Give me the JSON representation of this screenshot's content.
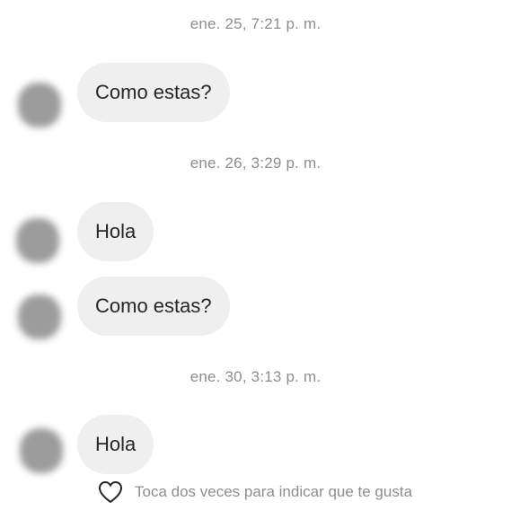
{
  "thread": {
    "timestamps": [
      "ene. 25, 7:21 p. m.",
      "ene. 26, 3:29 p. m.",
      "ene. 30, 3:13 p. m."
    ],
    "messages": [
      {
        "text": "Como estas?"
      },
      {
        "text": "Hola"
      },
      {
        "text": "Como estas?"
      },
      {
        "text": "Hola"
      }
    ],
    "like_hint": "Toca dos veces para indicar que te gusta"
  },
  "icons": {
    "like": "heart-outline-icon",
    "avatar": "blurred-avatar"
  },
  "colors": {
    "background": "#ffffff",
    "bubble": "#efefef",
    "message_text": "#262626",
    "meta_text": "#8e8e8e",
    "avatar": "#9c9c9c"
  }
}
